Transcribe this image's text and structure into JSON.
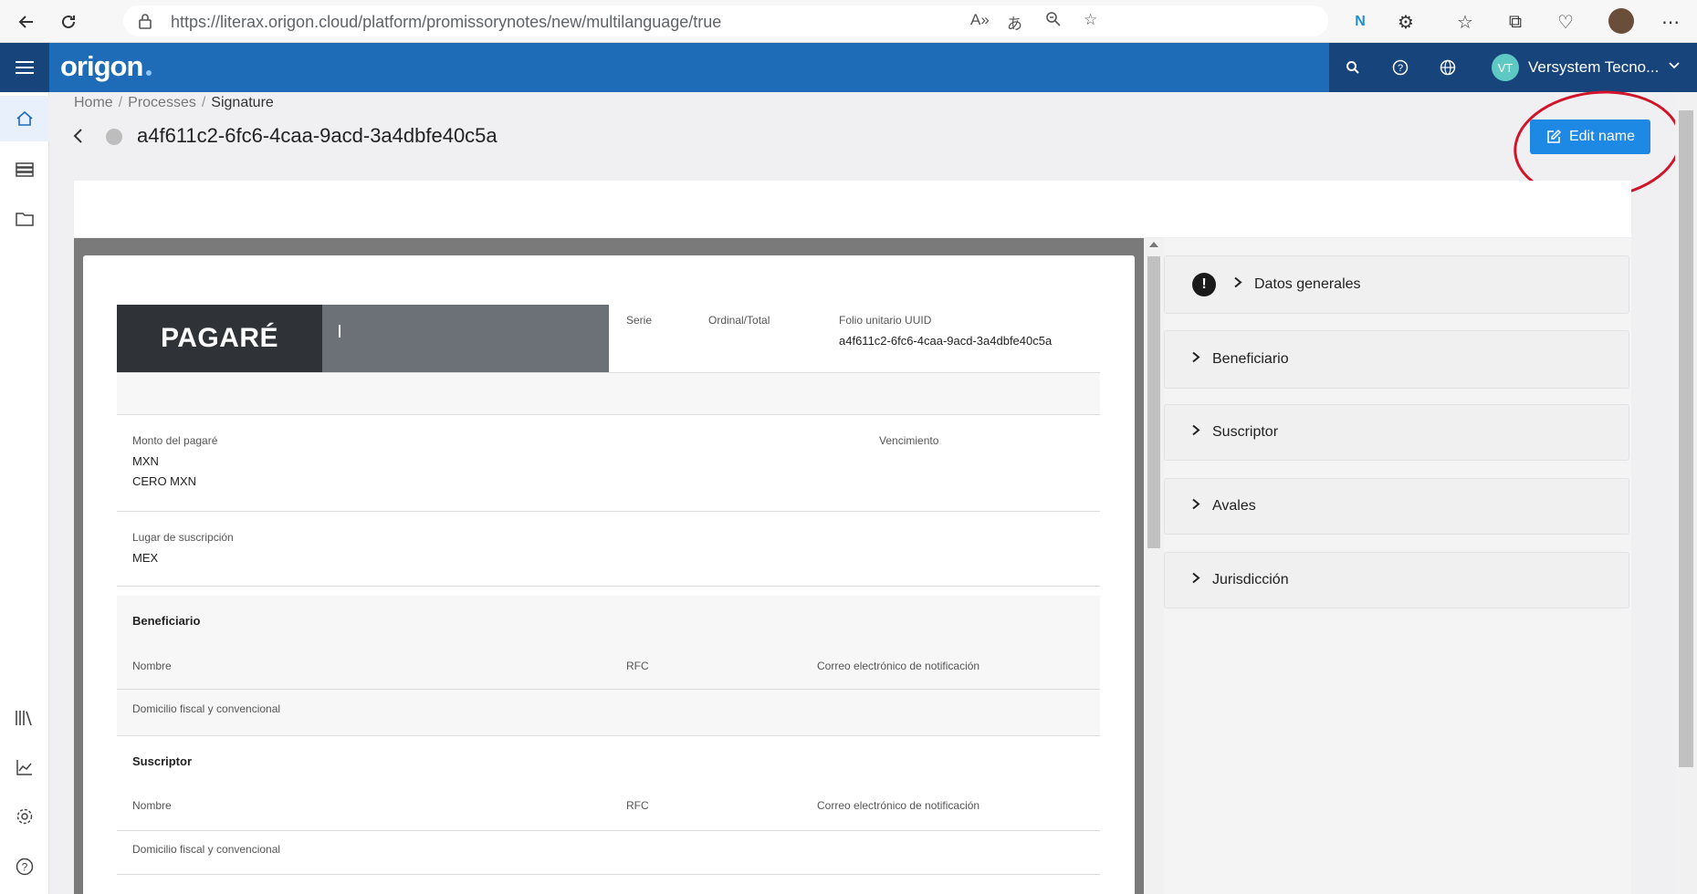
{
  "browser": {
    "url": "https://literax.origon.cloud/platform/promissorynotes/new/multilanguage/true"
  },
  "app": {
    "logo": "origon",
    "user": {
      "initials": "VT",
      "name": "Versystem Tecno..."
    }
  },
  "breadcrumb": {
    "home": "Home",
    "processes": "Processes",
    "current": "Signature",
    "separator": "/"
  },
  "page": {
    "title": "a4f611c2-6fc6-4caa-9acd-3a4dbfe40c5a",
    "edit_button": "Edit name"
  },
  "document": {
    "heading": "PAGARÉ",
    "serie_label": "Serie",
    "ordinal_label": "Ordinal/Total",
    "folio_label": "Folio unitario UUID",
    "folio_value": "a4f611c2-6fc6-4caa-9acd-3a4dbfe40c5a",
    "monto_label": "Monto del pagaré",
    "monto_currency": "MXN",
    "monto_words": "CERO MXN",
    "vencimiento_label": "Vencimiento",
    "lugar_label": "Lugar de suscripción",
    "lugar_value": "MEX",
    "beneficiario_title": "Beneficiario",
    "suscriptor_title": "Suscriptor",
    "nombre_label": "Nombre",
    "rfc_label": "RFC",
    "correo_label": "Correo electrónico de notificación",
    "domicilio_label": "Domicilio fiscal y convencional"
  },
  "accordion": [
    {
      "label": "Datos generales",
      "alert": true
    },
    {
      "label": "Beneficiario",
      "alert": false
    },
    {
      "label": "Suscriptor",
      "alert": false
    },
    {
      "label": "Avales",
      "alert": false
    },
    {
      "label": "Jurisdicción",
      "alert": false
    }
  ],
  "colors": {
    "header": "#1e6bb8",
    "header_dark": "#17447a",
    "accent_button": "#1e88e5",
    "annotation": "#d0152b"
  }
}
